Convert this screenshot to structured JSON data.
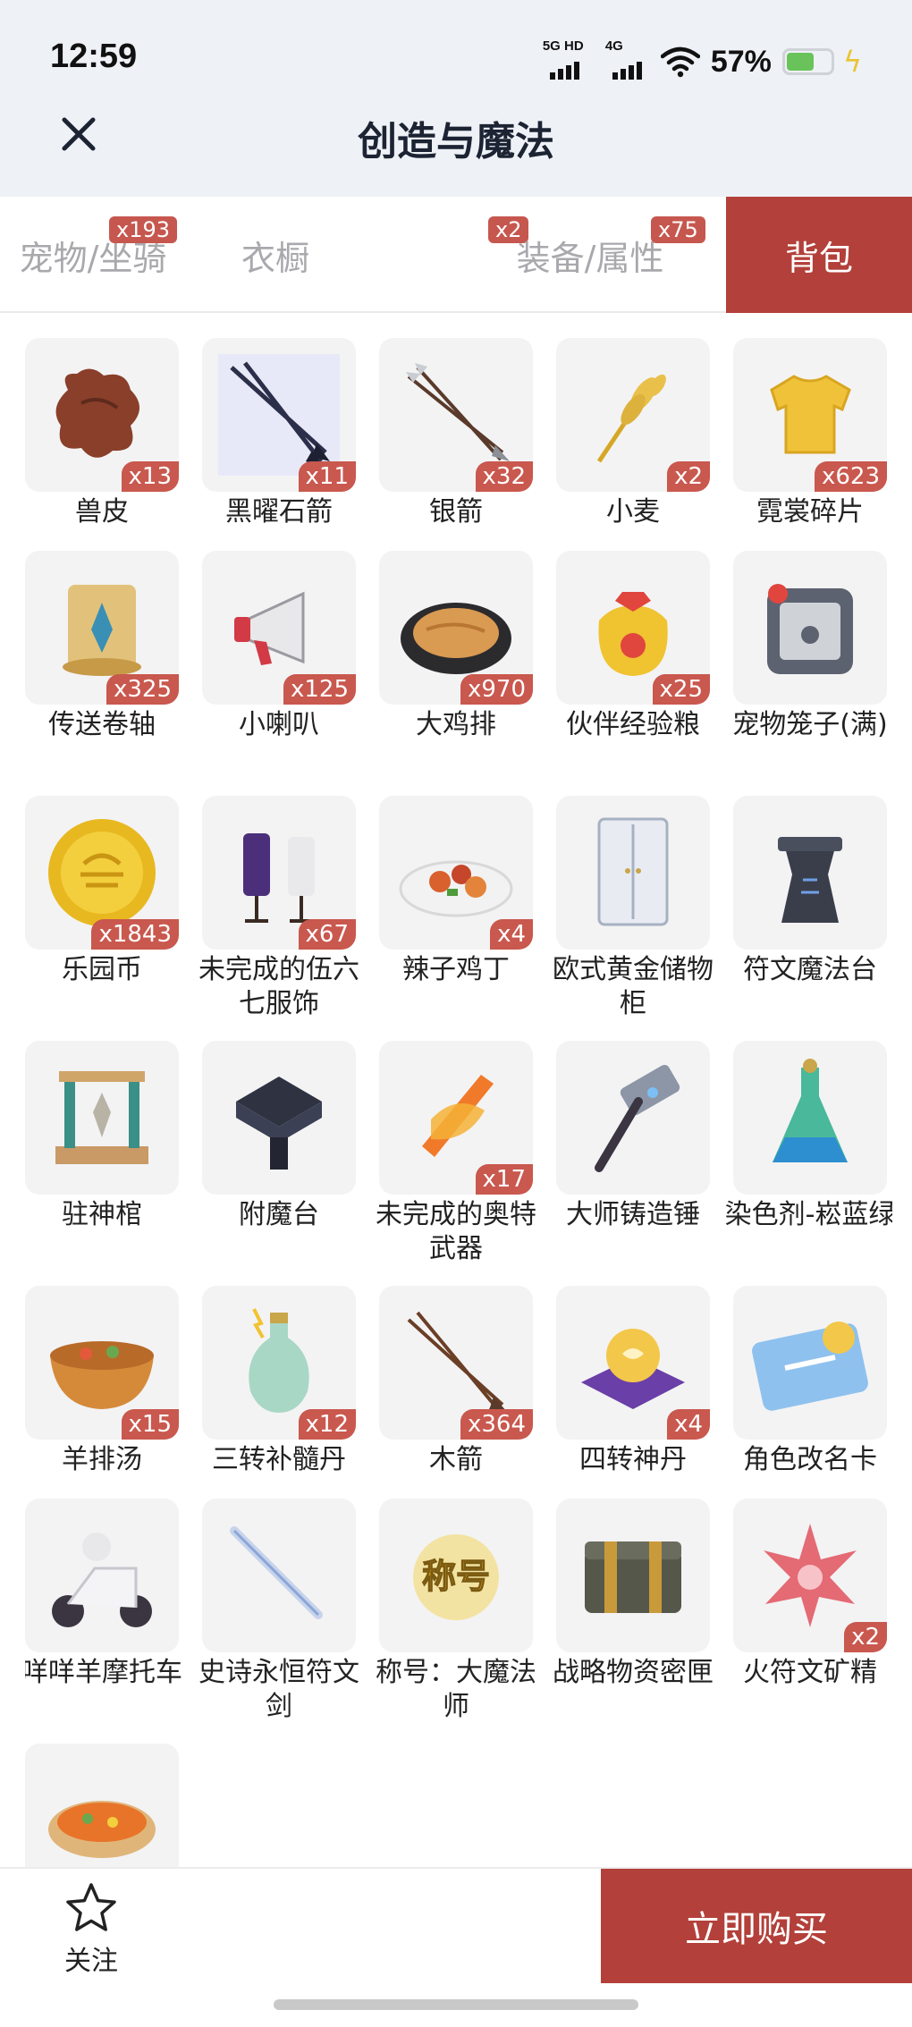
{
  "status": {
    "time": "12:59",
    "net1": "5G HD",
    "net2": "4G",
    "battery": "57%",
    "battery_level": 0.57,
    "battery_color": "#6ac35a"
  },
  "header": {
    "title": "创造与魔法",
    "close_icon": "close-icon"
  },
  "tabs": [
    {
      "label": "宠物/坐骑",
      "badge": "x193"
    },
    {
      "label": "衣橱",
      "badge": ""
    },
    {
      "label": "装备/属性",
      "badge": "x2"
    },
    {
      "label": "背包",
      "badge": "x75"
    }
  ],
  "tabs_extra": {
    "active_index": 3,
    "accent": "#b3403a",
    "badge_color": "#c6574f"
  },
  "items": [
    {
      "name": "兽皮",
      "qty": "x13",
      "icon": "hide-icon"
    },
    {
      "name": "黑曜石箭",
      "qty": "x11",
      "icon": "obsidian-arrow-icon"
    },
    {
      "name": "银箭",
      "qty": "x32",
      "icon": "silver-arrow-icon"
    },
    {
      "name": "小麦",
      "qty": "x2",
      "icon": "wheat-icon"
    },
    {
      "name": "霓裳碎片",
      "qty": "x623",
      "icon": "cloth-shard-icon"
    },
    {
      "name": "传送卷轴",
      "qty": "x325",
      "icon": "teleport-scroll-icon"
    },
    {
      "name": "小喇叭",
      "qty": "x125",
      "icon": "megaphone-icon"
    },
    {
      "name": "大鸡排",
      "qty": "x970",
      "icon": "chicken-cutlet-icon"
    },
    {
      "name": "伙伴经验粮",
      "qty": "x25",
      "icon": "pet-food-bag-icon"
    },
    {
      "name": "宠物笼子(满)",
      "qty": "",
      "icon": "pet-cage-icon"
    },
    {
      "name": "乐园币",
      "qty": "x1843",
      "icon": "coin-icon"
    },
    {
      "name": "未完成的伍六七服饰",
      "qty": "x67",
      "icon": "costume-icon"
    },
    {
      "name": "辣子鸡丁",
      "qty": "x4",
      "icon": "spicy-chicken-icon"
    },
    {
      "name": "欧式黄金储物柜",
      "qty": "",
      "icon": "wardrobe-icon"
    },
    {
      "name": "符文魔法台",
      "qty": "",
      "icon": "rune-altar-icon"
    },
    {
      "name": "驻神棺",
      "qty": "",
      "icon": "shrine-icon"
    },
    {
      "name": "附魔台",
      "qty": "",
      "icon": "enchant-table-icon"
    },
    {
      "name": "未完成的奥特武器",
      "qty": "x17",
      "icon": "ultra-weapon-icon"
    },
    {
      "name": "大师铸造锤",
      "qty": "",
      "icon": "hammer-icon"
    },
    {
      "name": "染色剂-崧蓝绿",
      "qty": "",
      "icon": "dye-potion-icon"
    },
    {
      "name": "羊排汤",
      "qty": "x15",
      "icon": "soup-bowl-icon"
    },
    {
      "name": "三转补髓丹",
      "qty": "x12",
      "icon": "elixir-bottle-icon"
    },
    {
      "name": "木箭",
      "qty": "x364",
      "icon": "wood-arrow-icon"
    },
    {
      "name": "四转神丹",
      "qty": "x4",
      "icon": "divine-pill-icon"
    },
    {
      "name": "角色改名卡",
      "qty": "",
      "icon": "rename-card-icon"
    },
    {
      "name": "咩咩羊摩托车",
      "qty": "",
      "icon": "scooter-icon"
    },
    {
      "name": "史诗永恒符文剑",
      "qty": "",
      "icon": "rune-sword-icon"
    },
    {
      "name": "称号：大魔法师",
      "qty": "",
      "icon": "title-badge-icon",
      "badge_text": "称号"
    },
    {
      "name": "战略物资密匣",
      "qty": "",
      "icon": "supply-crate-icon"
    },
    {
      "name": "火符文矿精",
      "qty": "x2",
      "icon": "fire-crystal-icon"
    },
    {
      "name": "",
      "qty": "",
      "icon": "stew-pot-icon"
    }
  ],
  "bottom": {
    "follow_label": "关注",
    "buy_label": "立即购买",
    "star_icon": "star-icon"
  }
}
